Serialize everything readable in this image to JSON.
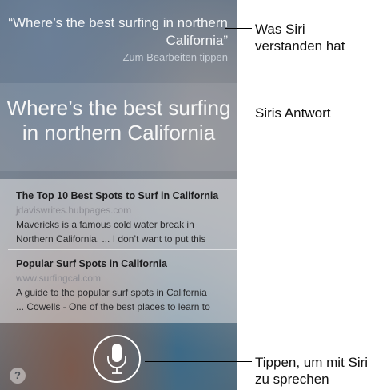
{
  "siri": {
    "query": "“Where’s the best surfing in northern California”",
    "hint": "Zum Bearbeiten tippen",
    "answer": "Where’s the best surfing in northern California"
  },
  "results": [
    {
      "title": "The Top 10 Best Spots to Surf in California",
      "url": "jdaviswrites.hubpages.com",
      "line1": "Mavericks is a famous cold water break in",
      "line2": "Northern California. ... I don’t want to put this"
    },
    {
      "title": "Popular Surf Spots in California",
      "url": "www.surfingcal.com",
      "line1": "A guide to the popular surf spots in California",
      "line2": "... Cowells - One of the best places to learn to"
    }
  ],
  "help_label": "?",
  "callouts": {
    "understood_line1": "Was Siri",
    "understood_line2": "verstanden hat",
    "answer": "Siris Antwort",
    "tap_line1": "Tippen, um mit Siri",
    "tap_line2": "zu sprechen"
  }
}
